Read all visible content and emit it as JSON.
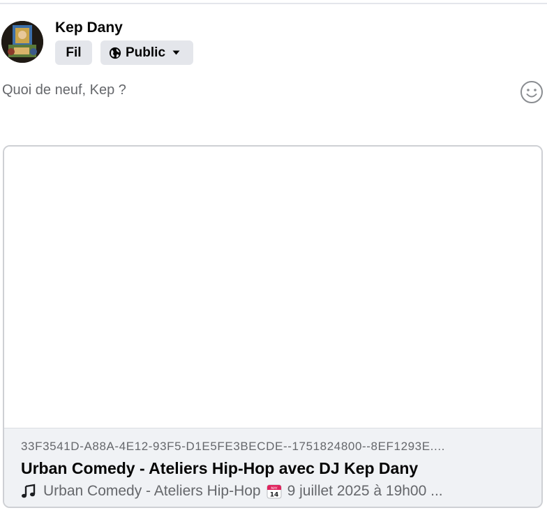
{
  "author": {
    "name": "Kep Dany"
  },
  "post_settings": {
    "destination_label": "Fil",
    "audience_label": "Public"
  },
  "composer": {
    "placeholder": "Quoi de neuf, Kep ?"
  },
  "link_preview": {
    "domain": "33F3541D-A88A-4E12-93F5-D1E5FE3BECDE--1751824800--8EF1293E....",
    "title": "Urban Comedy - Ateliers Hip-Hop avec DJ Kep Dany",
    "description_part1": "Urban Comedy - Ateliers Hip-Hop",
    "description_part2": "9 juillet 2025 à 19h00 ...",
    "calendar_month": "MAY",
    "calendar_day": "14"
  },
  "icons": {
    "audience": "globe-icon",
    "audience_dropdown": "caret-down-icon",
    "emoji": "smiley-icon",
    "music": "music-note-icon",
    "calendar": "calendar-icon"
  },
  "colors": {
    "pill_background": "#e4e6eb",
    "secondary_text": "#65676b",
    "primary_text": "#050505",
    "card_footer": "#f0f2f5",
    "card_border": "#ced0d4"
  }
}
